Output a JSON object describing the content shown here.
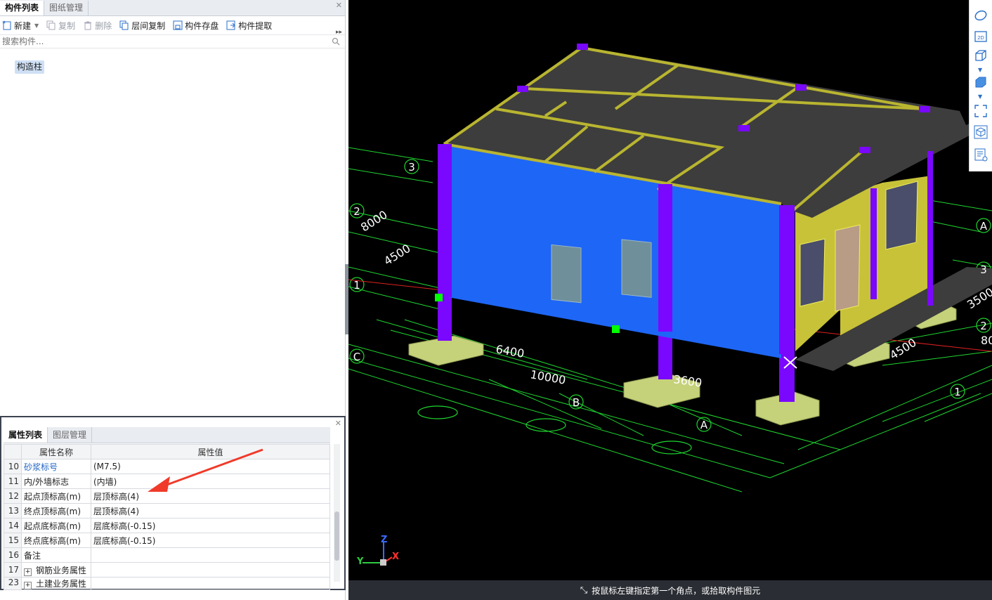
{
  "component_panel": {
    "tabs": [
      "构件列表",
      "图纸管理"
    ],
    "toolbar": {
      "new": "新建",
      "copy": "复制",
      "delete": "删除",
      "floor_copy": "层间复制",
      "save": "构件存盘",
      "extract": "构件提取"
    },
    "search_placeholder": "搜索构件...",
    "items": [
      "构造柱"
    ]
  },
  "property_panel": {
    "tabs": [
      "属性列表",
      "图层管理"
    ],
    "headers": {
      "name": "属性名称",
      "value": "属性值"
    },
    "rows": [
      {
        "num": "10",
        "name": "砂浆标号",
        "value": "(M7.5)"
      },
      {
        "num": "11",
        "name": "内/外墙标志",
        "value": "(内墙)"
      },
      {
        "num": "12",
        "name": "起点顶标高(m)",
        "value": "层顶标高(4)"
      },
      {
        "num": "13",
        "name": "终点顶标高(m)",
        "value": "层顶标高(4)"
      },
      {
        "num": "14",
        "name": "起点底标高(m)",
        "value": "层底标高(-0.15)"
      },
      {
        "num": "15",
        "name": "终点底标高(m)",
        "value": "层底标高(-0.15)"
      },
      {
        "num": "16",
        "name": "备注",
        "value": ""
      },
      {
        "num": "17",
        "name": "钢筋业务属性",
        "value": ""
      },
      {
        "num": "23",
        "name": "土建业务属性",
        "value": ""
      }
    ]
  },
  "viewport": {
    "dims": {
      "d6400": "6400",
      "d10000": "10000",
      "d3600": "3600",
      "d8000": "8000",
      "d4500a": "4500",
      "d4500b": "4500",
      "d3500": "3500",
      "d80": "80"
    },
    "axes": {
      "a3": "3",
      "a2": "2",
      "a1": "1",
      "aC": "C",
      "aB": "B",
      "aA": "A",
      "r3": "3",
      "r2": "2",
      "r1": "1",
      "rA": "A"
    },
    "gizmo": {
      "x": "X",
      "y": "Y",
      "z": "Z"
    }
  },
  "status_text": "按鼠标左键指定第一个角点，或拾取构件图元",
  "view_tools": [
    "orbit-icon",
    "view-2d-icon",
    "view-3d-icon",
    "solid-icon",
    "fullscreen-icon",
    "cube-icon",
    "props-icon"
  ],
  "colors": {
    "wall_blue": "#1e66f5",
    "wall_yellow": "#c7c238",
    "column": "#7a08ff",
    "beam": "#b9b530",
    "slab": "#3d3d3d",
    "footing": "#c6d27a",
    "grid": "#1fd630"
  }
}
